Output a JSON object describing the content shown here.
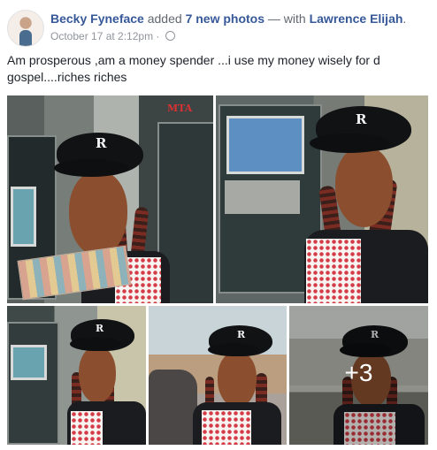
{
  "header": {
    "name": "Becky Fyneface",
    "action_prefix": " added ",
    "photo_count": "7 new photos",
    "with_text": " — with ",
    "tagged": "Lawrence Elijah",
    "period": ".",
    "timestamp": "October 17 at 2:12pm",
    "separator": " · ",
    "privacy_icon": "globe-icon"
  },
  "post": {
    "text": "Am prosperous ,am a money spender ...i use my money wisely for d gospel....riches riches"
  },
  "photos": {
    "p1_atm_label": "MTA",
    "p1_cap_logo": "R",
    "p2_cap_logo": "R",
    "p3_cap_logo": "R",
    "p4_cap_logo": "R",
    "p5_cap_logo": "R",
    "more_count": "+3"
  }
}
